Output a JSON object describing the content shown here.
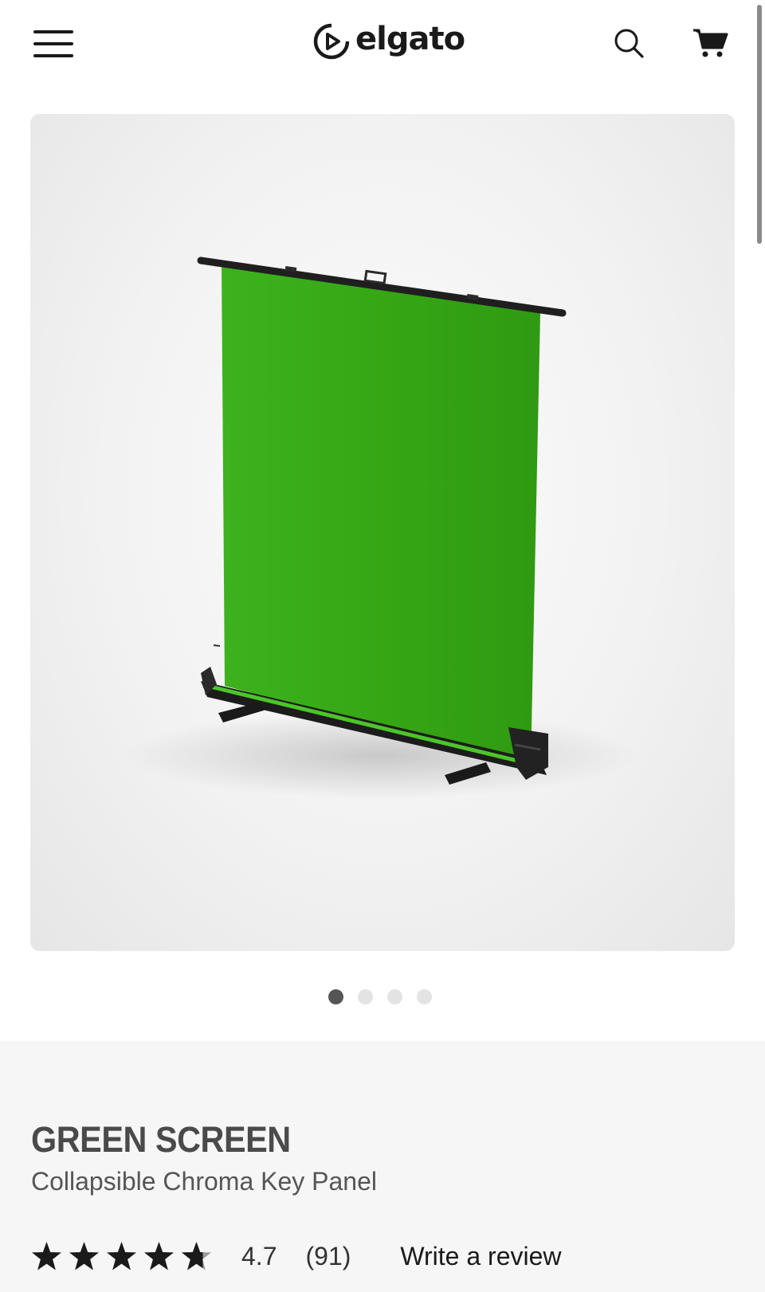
{
  "header": {
    "brand": "elgato",
    "menu_icon": "hamburger-menu-icon",
    "search_icon": "search-icon",
    "cart_icon": "shopping-cart-icon"
  },
  "product": {
    "image_alt": "Green screen collapsible panel",
    "carousel": {
      "total": 4,
      "active_index": 0
    },
    "title": "GREEN SCREEN",
    "subtitle": "Collapsible Chroma Key Panel",
    "rating": {
      "stars_value": 4.7,
      "value_text": "4.7",
      "count_text": "(91)",
      "write_review_label": "Write a review"
    }
  },
  "colors": {
    "screen_green": "#3aa81c",
    "text_dark": "#1a1a1a",
    "title_gray": "#4a4a4a",
    "info_bg": "#f6f6f6",
    "dot_active": "#555555",
    "dot_inactive": "#e3e3e3"
  }
}
